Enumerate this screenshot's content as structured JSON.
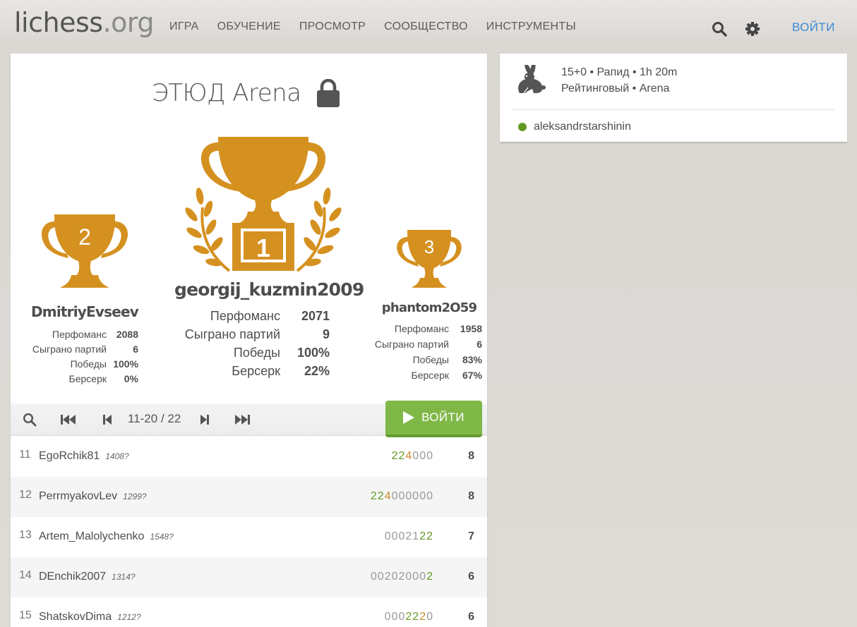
{
  "header": {
    "logo_main": "lichess",
    "logo_tld": ".org",
    "nav": [
      "ИГРА",
      "ОБУЧЕНИЕ",
      "ПРОСМОТР",
      "СООБЩЕСТВО",
      "ИНСТРУМЕНТЫ"
    ],
    "login": "ВОЙТИ"
  },
  "tournament": {
    "title": "ЭТЮД Arena"
  },
  "podium": {
    "first": {
      "place": "1",
      "name": "georgij_kuzmin2009",
      "stats": [
        {
          "k": "Перфоманс",
          "v": "2071"
        },
        {
          "k": "Сыграно партий",
          "v": "9"
        },
        {
          "k": "Победы",
          "v": "100%"
        },
        {
          "k": "Берсерк",
          "v": "22%"
        }
      ]
    },
    "second": {
      "place": "2",
      "name": "DmitriyEvseev",
      "stats": [
        {
          "k": "Перфоманс",
          "v": "2088"
        },
        {
          "k": "Сыграно партий",
          "v": "6"
        },
        {
          "k": "Победы",
          "v": "100%"
        },
        {
          "k": "Берсерк",
          "v": "0%"
        }
      ]
    },
    "third": {
      "place": "3",
      "name": "phantom2O59",
      "stats": [
        {
          "k": "Перфоманс",
          "v": "1958"
        },
        {
          "k": "Сыграно партий",
          "v": "6"
        },
        {
          "k": "Победы",
          "v": "83%"
        },
        {
          "k": "Берсерк",
          "v": "67%"
        }
      ]
    }
  },
  "pager": {
    "page_label": "11-20 / 22",
    "join": "ВОЙТИ"
  },
  "standings": [
    {
      "rank": "11",
      "name": "EgoRchik81",
      "rating": "1408?",
      "sheet": [
        [
          "w",
          "2"
        ],
        [
          "w",
          "2"
        ],
        [
          "d",
          "4"
        ],
        [
          "n",
          "000"
        ]
      ],
      "score": "8"
    },
    {
      "rank": "12",
      "name": "PerrmyakovLev",
      "rating": "1299?",
      "sheet": [
        [
          "w",
          "2"
        ],
        [
          "w",
          "2"
        ],
        [
          "d",
          "4"
        ],
        [
          "n",
          "000000"
        ]
      ],
      "score": "8"
    },
    {
      "rank": "13",
      "name": "Artem_Malolychenko",
      "rating": "1548?",
      "sheet": [
        [
          "n",
          "00021"
        ],
        [
          "w",
          "2"
        ],
        [
          "w",
          "2"
        ]
      ],
      "score": "7"
    },
    {
      "rank": "14",
      "name": "DEnchik2007",
      "rating": "1314?",
      "sheet": [
        [
          "n",
          "00202000"
        ],
        [
          "w",
          "2"
        ]
      ],
      "score": "6"
    },
    {
      "rank": "15",
      "name": "ShatskovDima",
      "rating": "1212?",
      "sheet": [
        [
          "n",
          "000"
        ],
        [
          "w",
          "2"
        ],
        [
          "w",
          "2"
        ],
        [
          "d",
          "2"
        ],
        [
          "n",
          "0"
        ]
      ],
      "score": "6"
    }
  ],
  "info": {
    "line1": "15+0 • Рапид • 1h 20m",
    "line2": "Рейтинговый • Arena",
    "creator": "aleksandrstarshinin"
  },
  "colors": {
    "trophy": "#d59120",
    "win": "#629924",
    "draw": "#c98a2a",
    "join_button": "#80b848",
    "link": "#3a8ad6"
  }
}
